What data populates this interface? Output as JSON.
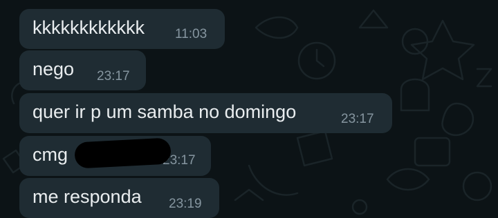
{
  "theme": {
    "background": "#0c1316",
    "incoming_bubble": "#1f2c33",
    "text": "#e9edef",
    "timestamp": "#8696a0",
    "redaction": "#000000"
  },
  "messages": [
    {
      "text": "kkkkkkkkkkkk",
      "time": "11:03"
    },
    {
      "text": "nego",
      "time": "23:17"
    },
    {
      "text": "quer ir p um samba no domingo",
      "time": "23:17"
    },
    {
      "text": "cmg",
      "time": "23:17",
      "partially_redacted": true
    },
    {
      "text": "me responda",
      "time": "23:19"
    }
  ]
}
